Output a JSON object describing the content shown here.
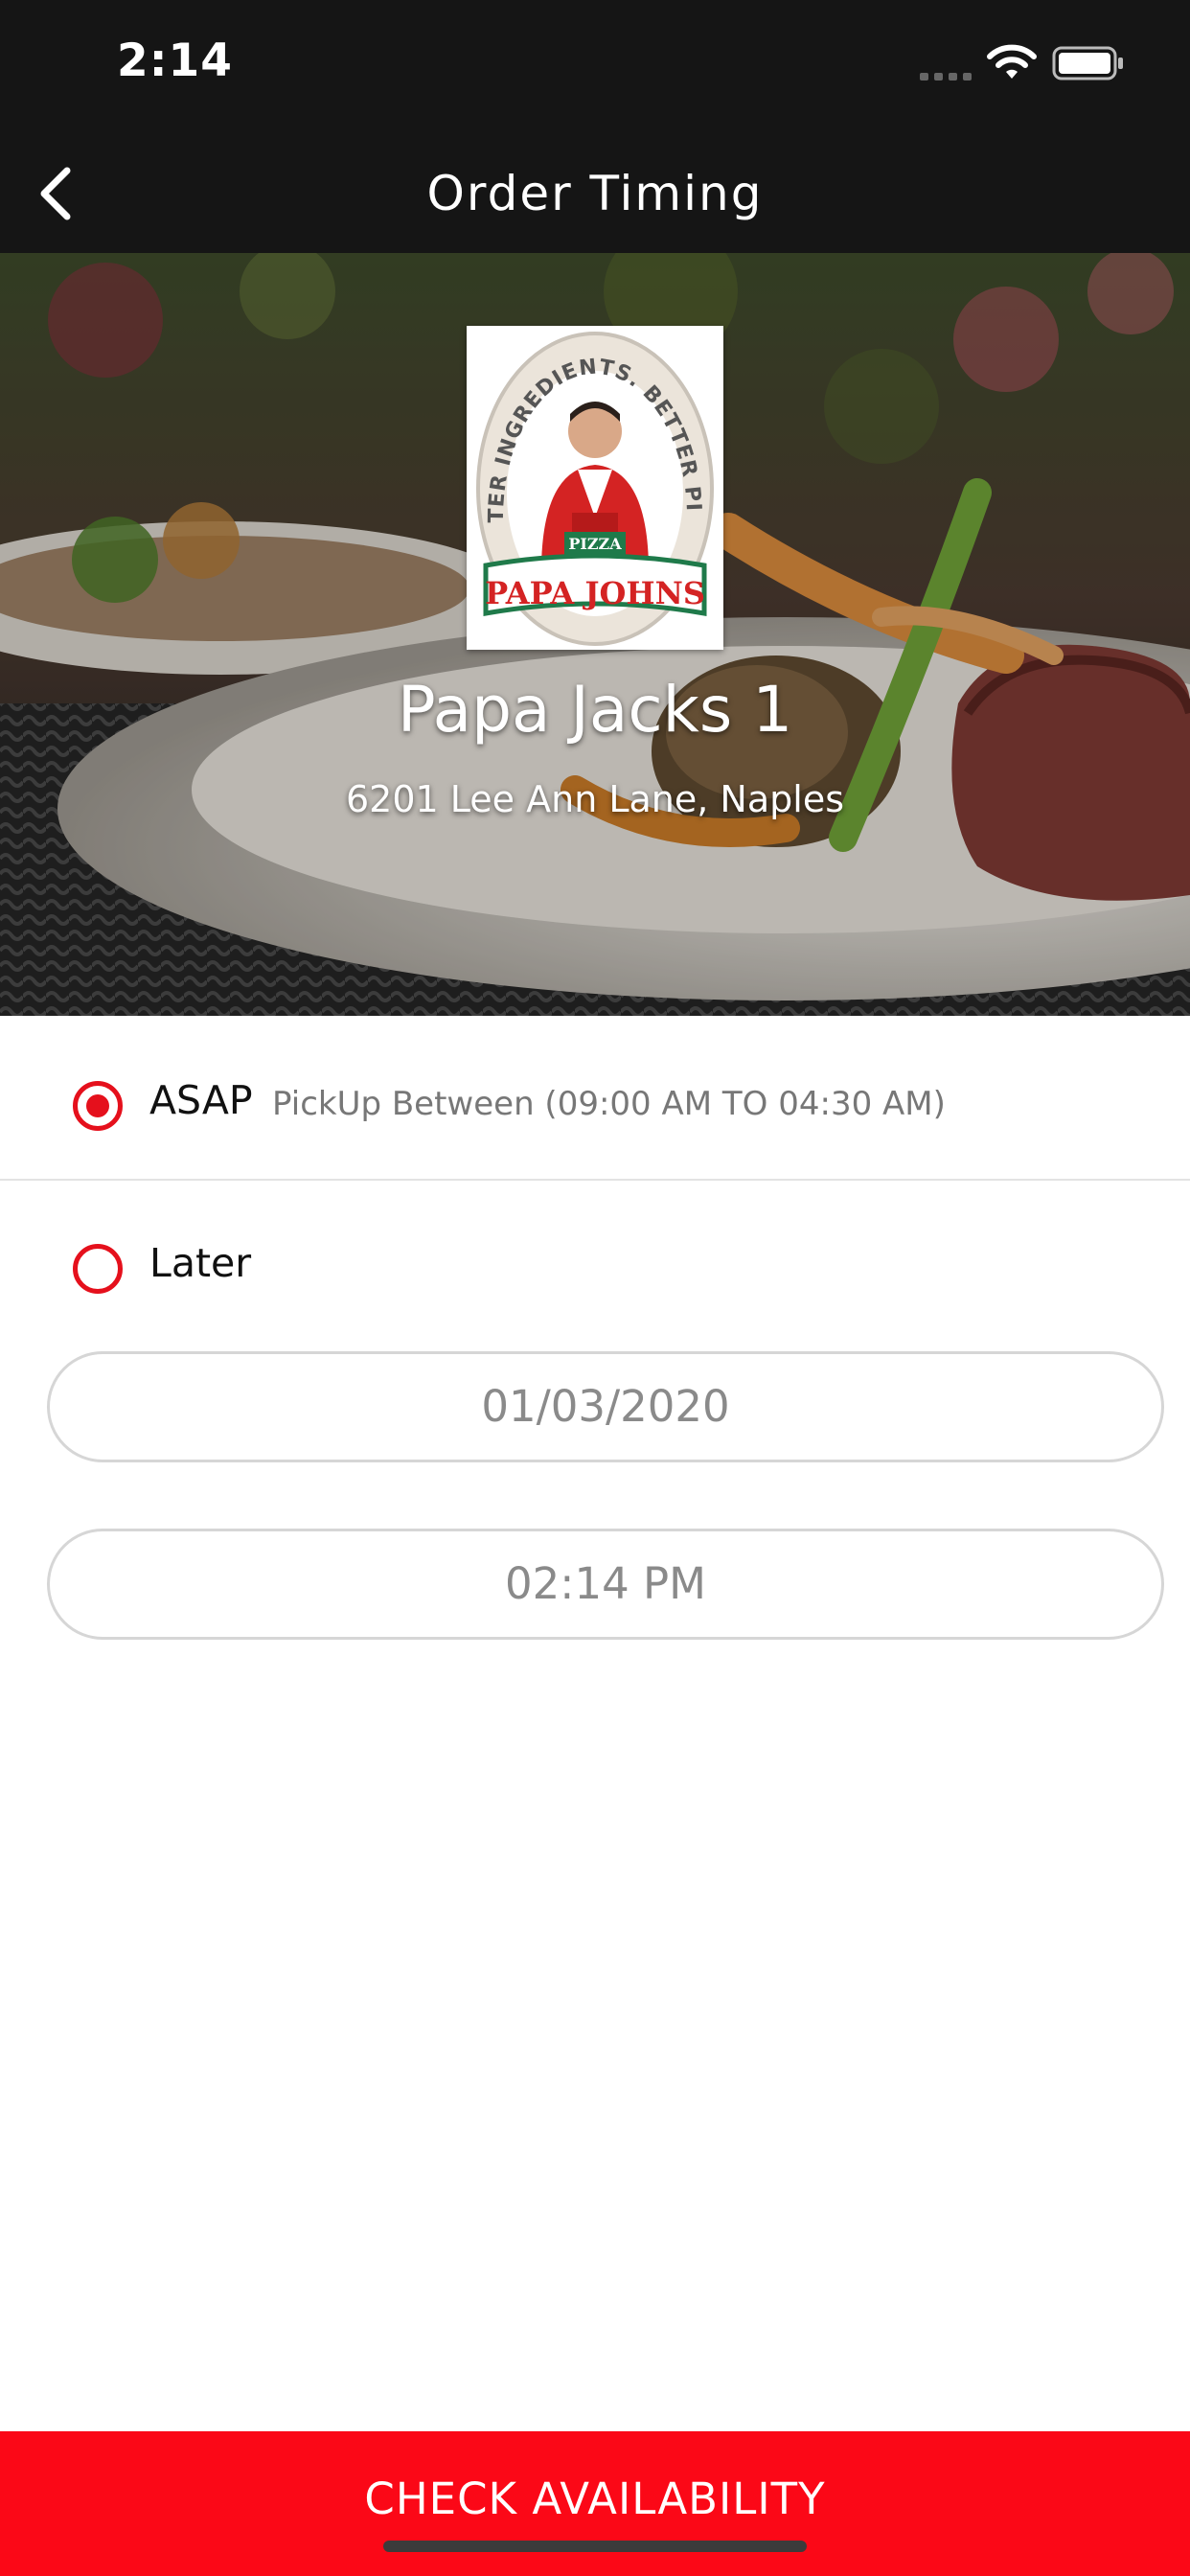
{
  "status_bar": {
    "time": "2:14"
  },
  "nav": {
    "title": "Order Timing",
    "back_icon": "chevron-left-icon"
  },
  "store": {
    "name": "Papa Jacks 1",
    "address": "6201 Lee Ann Lane, Naples",
    "logo": {
      "arc_text": "BETTER INGREDIENTS. BETTER PIZZA.",
      "badge_text": "PIZZA",
      "brand_text": "PAPA JOHNS"
    }
  },
  "options": {
    "asap": {
      "label": "ASAP",
      "sublabel": "PickUp Between (09:00 AM TO 04:30 AM)",
      "selected": true
    },
    "later": {
      "label": "Later",
      "selected": false,
      "date": "01/03/2020",
      "time": "02:14 PM"
    }
  },
  "actions": {
    "check_label": "CHECK AVAILABILITY"
  },
  "colors": {
    "accent": "#fb0817",
    "radio": "#e5101c",
    "header_bg": "#151515"
  }
}
